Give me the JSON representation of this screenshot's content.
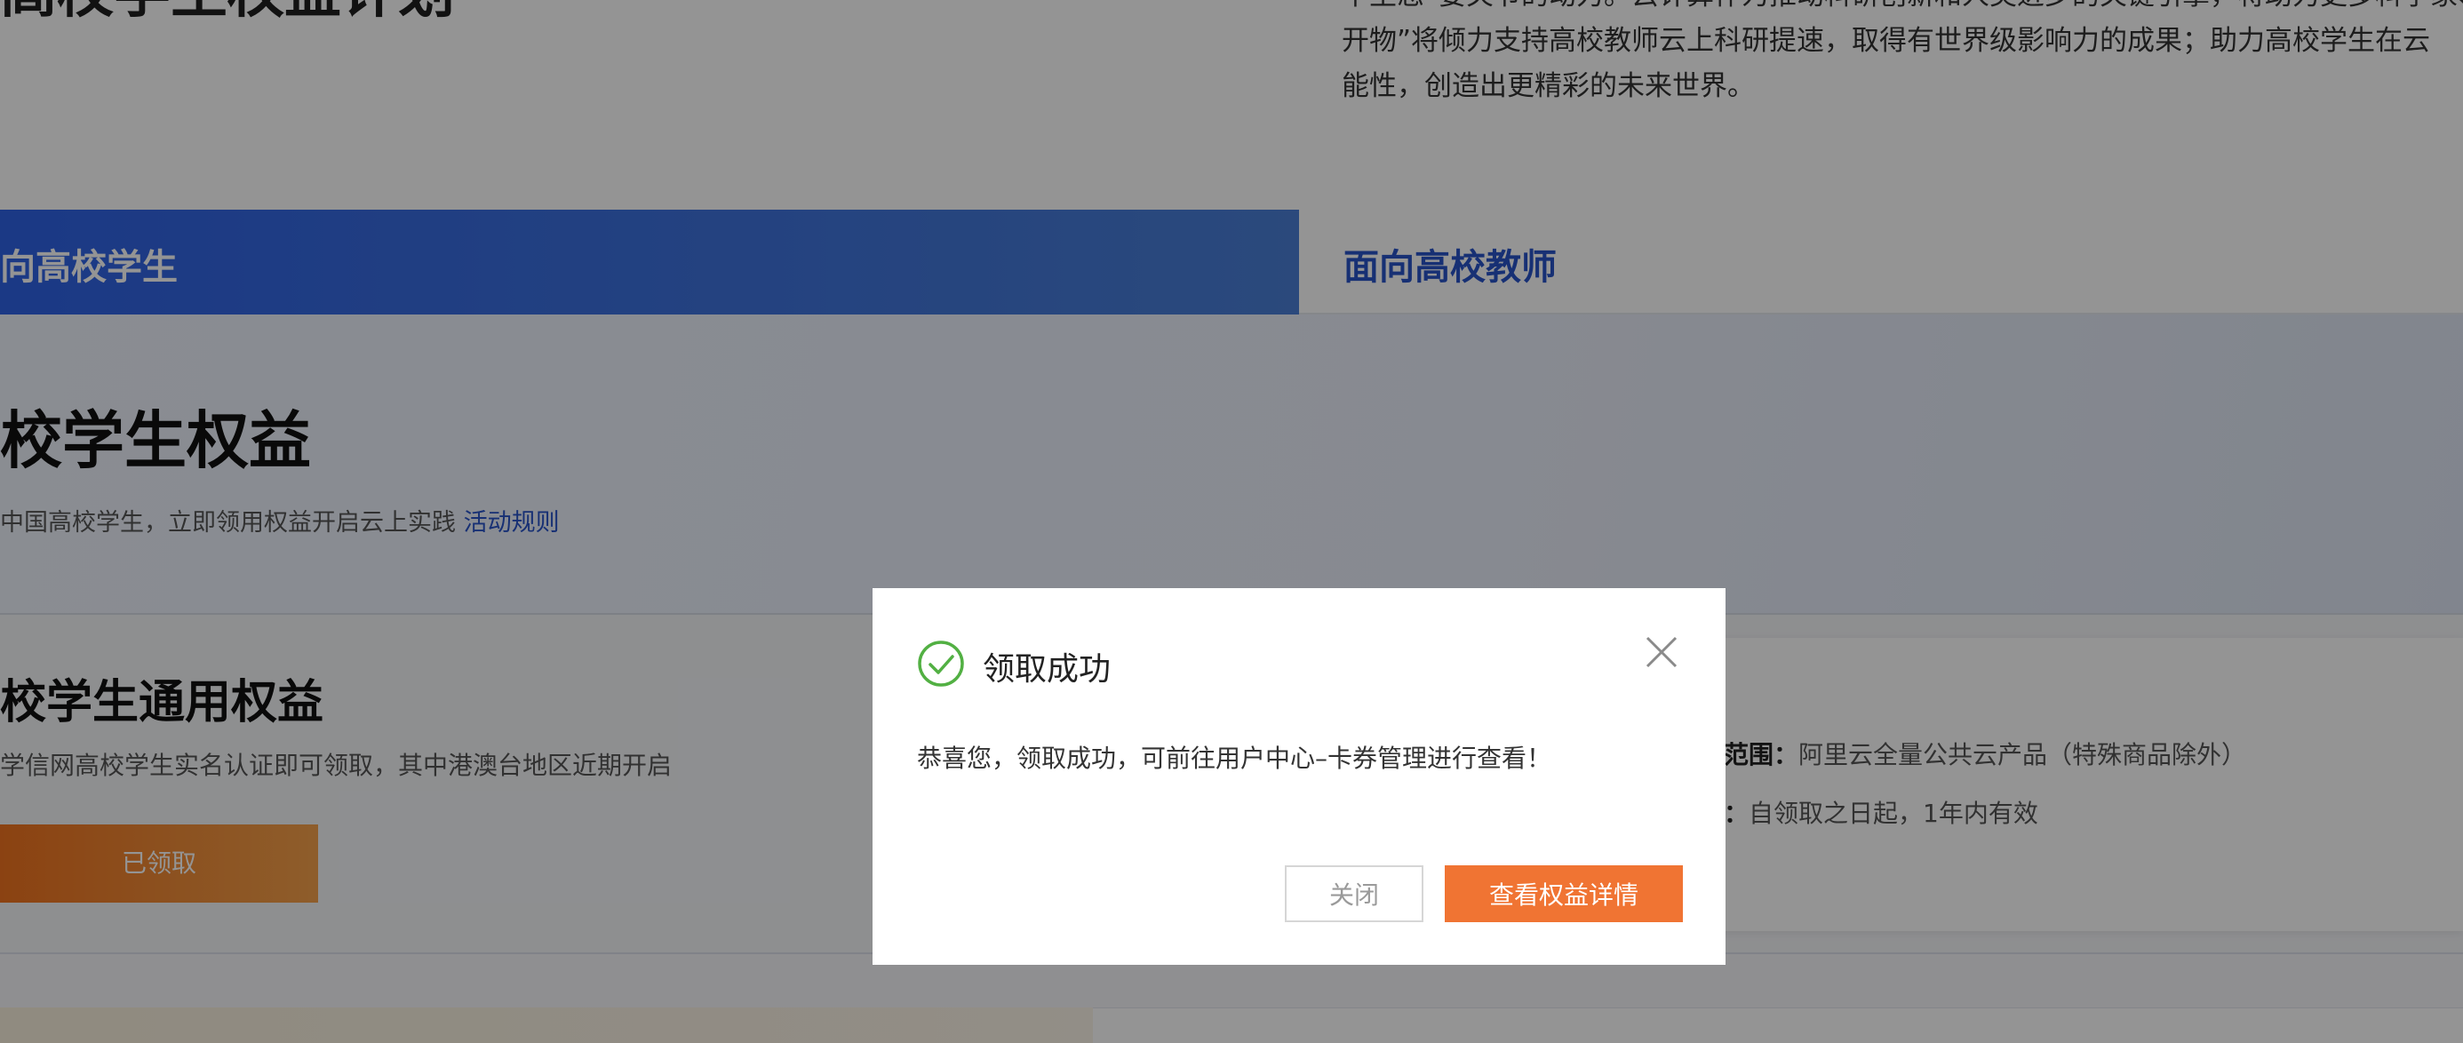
{
  "intro": {
    "hero_fragment": "高校学生权益计划",
    "lines": [
      "中生态“要关节的动力。云计算作为推动科研创新和人类进步的关键引擎，将助力更多科学家、学生和开",
      "开物”将倾力支持高校教师云上科研提速，取得有世界级影响力的成果；助力高校学生在云",
      "能性，创造出更精彩的未来世界。"
    ]
  },
  "tabs": {
    "student": "向高校学生",
    "teacher": "面向高校教师"
  },
  "student_section": {
    "title": "校学生权益",
    "desc": "中国高校学生，立即领用权益开启云上实践",
    "rules_link": "活动规则"
  },
  "general_card": {
    "title": "校学生通用权益",
    "desc": "学信网高校学生实名认证即可领取，其中港澳台地区近期开启",
    "claimed_button": "已领取"
  },
  "scope_card": {
    "scope_label": "范围：",
    "scope_value": "阿里云全量公共云产品（特殊商品除外）",
    "validity_label": "：",
    "validity_value": "自领取之日起，1年内有效"
  },
  "modal": {
    "title": "领取成功",
    "body": "恭喜您，领取成功，可前往用户中心–卡券管理进行查看！",
    "close_button": "关闭",
    "view_button": "查看权益详情",
    "success_color": "#52b043",
    "accent_color": "#f07433"
  }
}
